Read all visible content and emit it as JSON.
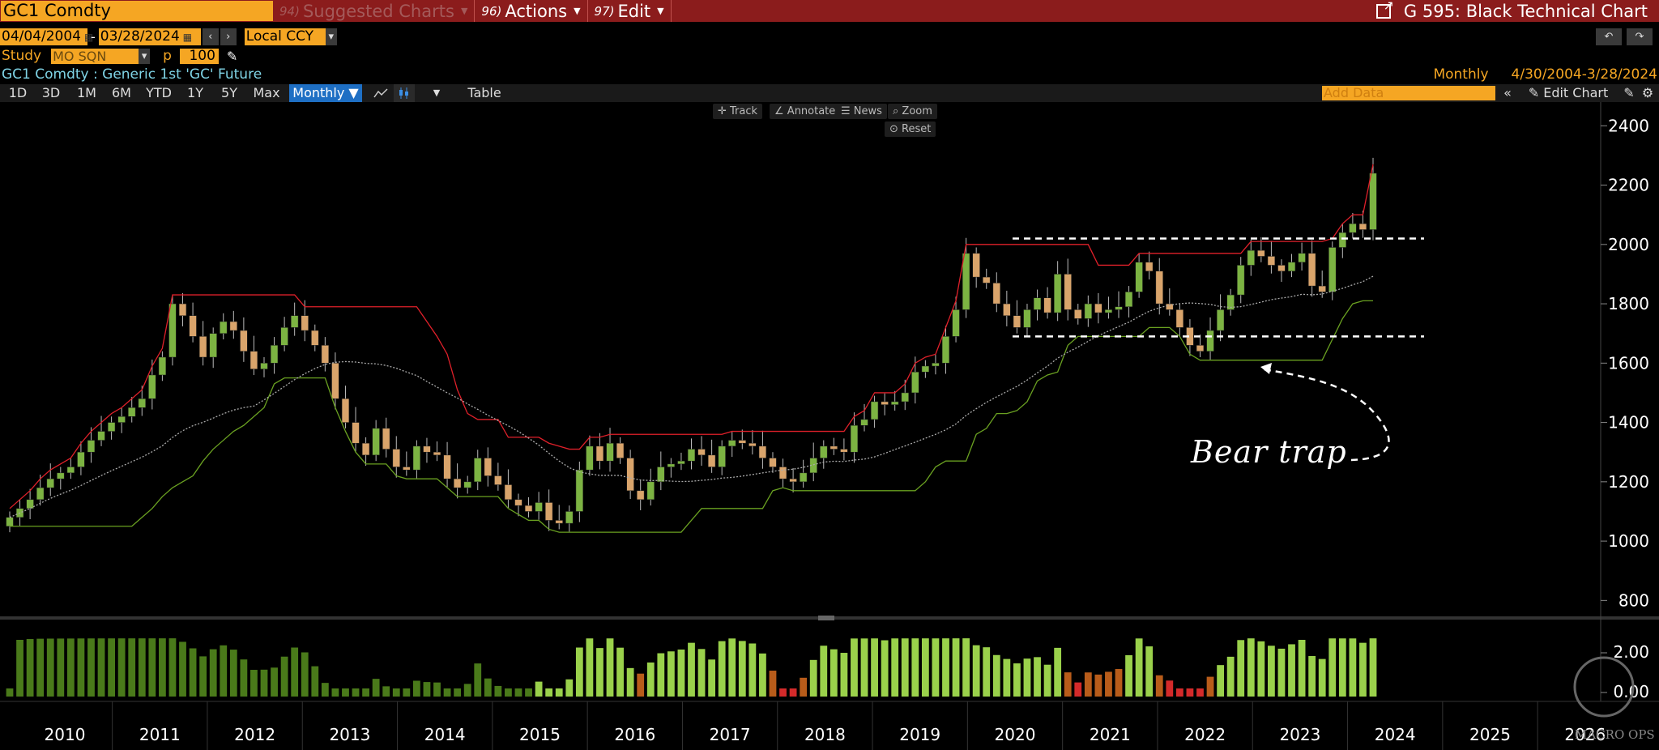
{
  "topbar": {
    "ticker": "GC1 Comdty",
    "suggested": {
      "num": "94)",
      "label": "Suggested Charts"
    },
    "actions": {
      "num": "96)",
      "label": "Actions"
    },
    "edit": {
      "num": "97)",
      "label": "Edit"
    },
    "title": "G 595: Black Technical Chart"
  },
  "range": {
    "start": "04/04/2004",
    "end": "03/28/2024",
    "currency": "Local CCY"
  },
  "study": {
    "label": "Study",
    "value": "MO SQN",
    "p_label": "p",
    "p_value": "100"
  },
  "security_desc": "GC1 Comdty : Generic 1st 'GC' Future",
  "period_info": {
    "frequency": "Monthly",
    "span": "4/30/2004-3/28/2024"
  },
  "periods": [
    "1D",
    "3D",
    "1M",
    "6M",
    "YTD",
    "1Y",
    "5Y",
    "Max"
  ],
  "frequency_select": "Monthly ▼",
  "table_label": "Table",
  "add_data_placeholder": "Add Data",
  "edit_chart_label": "Edit Chart",
  "chart_tools": [
    "Track",
    "Annotate",
    "News",
    "Zoom"
  ],
  "reset_label": "Reset",
  "annotation": "Bear trap",
  "watermark": "MACRO OPS",
  "colors": {
    "up": "#7cb342",
    "down": "#d9a46b",
    "upper_band": "#e0202a",
    "lower_band": "#6aa121",
    "mid": "#aaaaaa",
    "accent": "#f5a623",
    "topbar": "#8b1c1c"
  },
  "chart_data": {
    "type": "candlestick",
    "x_axis_labels": [
      "2010",
      "2011",
      "2012",
      "2013",
      "2014",
      "2015",
      "2016",
      "2017",
      "2018",
      "2019",
      "2020",
      "2021",
      "2022",
      "2023",
      "2024",
      "2025",
      "2026"
    ],
    "y_ticks": [
      800,
      1000,
      1200,
      1400,
      1600,
      1800,
      2000,
      2200,
      2400
    ],
    "ylim": [
      760,
      2480
    ],
    "close_series": [
      1080,
      1110,
      1140,
      1180,
      1210,
      1230,
      1250,
      1300,
      1340,
      1370,
      1400,
      1420,
      1450,
      1480,
      1560,
      1620,
      1800,
      1760,
      1690,
      1620,
      1700,
      1740,
      1710,
      1640,
      1580,
      1600,
      1660,
      1720,
      1760,
      1710,
      1660,
      1600,
      1480,
      1400,
      1330,
      1290,
      1380,
      1310,
      1250,
      1240,
      1320,
      1300,
      1290,
      1210,
      1180,
      1200,
      1280,
      1220,
      1190,
      1140,
      1120,
      1100,
      1130,
      1070,
      1060,
      1100,
      1240,
      1320,
      1270,
      1330,
      1280,
      1170,
      1140,
      1200,
      1250,
      1260,
      1270,
      1310,
      1290,
      1250,
      1320,
      1340,
      1330,
      1320,
      1280,
      1250,
      1210,
      1200,
      1230,
      1280,
      1320,
      1310,
      1300,
      1390,
      1410,
      1470,
      1460,
      1470,
      1500,
      1570,
      1590,
      1600,
      1690,
      1780,
      1970,
      1890,
      1870,
      1800,
      1760,
      1720,
      1780,
      1820,
      1770,
      1900,
      1780,
      1750,
      1800,
      1770,
      1780,
      1790,
      1840,
      1940,
      1910,
      1800,
      1780,
      1720,
      1660,
      1640,
      1710,
      1780,
      1830,
      1930,
      1980,
      1960,
      1930,
      1910,
      1940,
      1970,
      1860,
      1840,
      1990,
      2040,
      2070,
      2050,
      2240
    ],
    "volume_oscillator": {
      "y_ticks": [
        "2.00",
        "0.00"
      ]
    },
    "series": [
      {
        "name": "Upper band"
      },
      {
        "name": "Lower band"
      },
      {
        "name": "Moving average"
      }
    ],
    "annotations": {
      "resistance_level": 2020,
      "support_level": 1690,
      "bear_trap_label": "Bear trap"
    }
  }
}
